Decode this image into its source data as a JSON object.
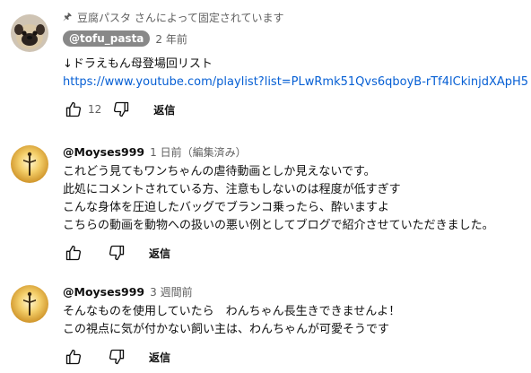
{
  "comments": [
    {
      "pinned_text": "豆腐パスタ さんによって固定されています",
      "author": "@tofu_pasta",
      "time": "2 年前",
      "lines": [
        "↓ドラえもん母登場回リスト"
      ],
      "link": "https://www.youtube.com/playlist?list=PLwRmk51Qvs6qboyB-rTf4lCkinjdXApH5",
      "likes": "12",
      "reply_label": "返信",
      "avatar": "pug-avatar"
    },
    {
      "author": "@Moyses999",
      "time": "1 日前（編集済み）",
      "lines": [
        "これどう見てもワンちゃんの虐待動画としか見えないです。",
        "此処にコメントされている方、注意もしないのは程度が低すぎす",
        "こんな身体を圧迫したバッグでブランコ乗ったら、酔いますよ",
        "こちらの動画を動物への扱いの悪い例としてブログで紹介させていただきました。"
      ],
      "likes": "",
      "reply_label": "返信",
      "avatar": "sunset-figure-avatar"
    },
    {
      "author": "@Moyses999",
      "time": "3 週間前",
      "lines": [
        "そんなものを使用していたら　わんちゃん長生きできませんよ！",
        "この視点に気が付かない飼い主は、わんちゃんが可愛そうです"
      ],
      "likes": "",
      "reply_label": "返信",
      "avatar": "sunset-figure-avatar"
    }
  ],
  "colors": {
    "link": "#065fd4",
    "secondary_text": "#606060",
    "author_chip_bg": "#888888"
  }
}
